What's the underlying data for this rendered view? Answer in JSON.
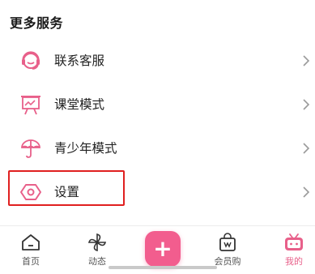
{
  "section": {
    "title": "更多服务"
  },
  "menu": {
    "items": [
      {
        "label": "联系客服",
        "icon": "headset-icon"
      },
      {
        "label": "课堂模式",
        "icon": "presentation-board-icon"
      },
      {
        "label": "青少年模式",
        "icon": "umbrella-icon"
      },
      {
        "label": "设置",
        "icon": "hex-nut-settings-icon"
      }
    ],
    "chevron": "›"
  },
  "tabbar": {
    "tabs": [
      {
        "label": "首页",
        "icon": "home-icon"
      },
      {
        "label": "动态",
        "icon": "pinwheel-icon"
      },
      {
        "label": "会员购",
        "icon": "shopping-bag-icon"
      },
      {
        "label": "我的",
        "icon": "tv-mascot-icon"
      }
    ],
    "plus_label": "+",
    "active_tab": "我的"
  },
  "colors": {
    "accent": "#f25d8e",
    "icon_pink": "#e8608a",
    "highlight_red": "#e02020"
  }
}
